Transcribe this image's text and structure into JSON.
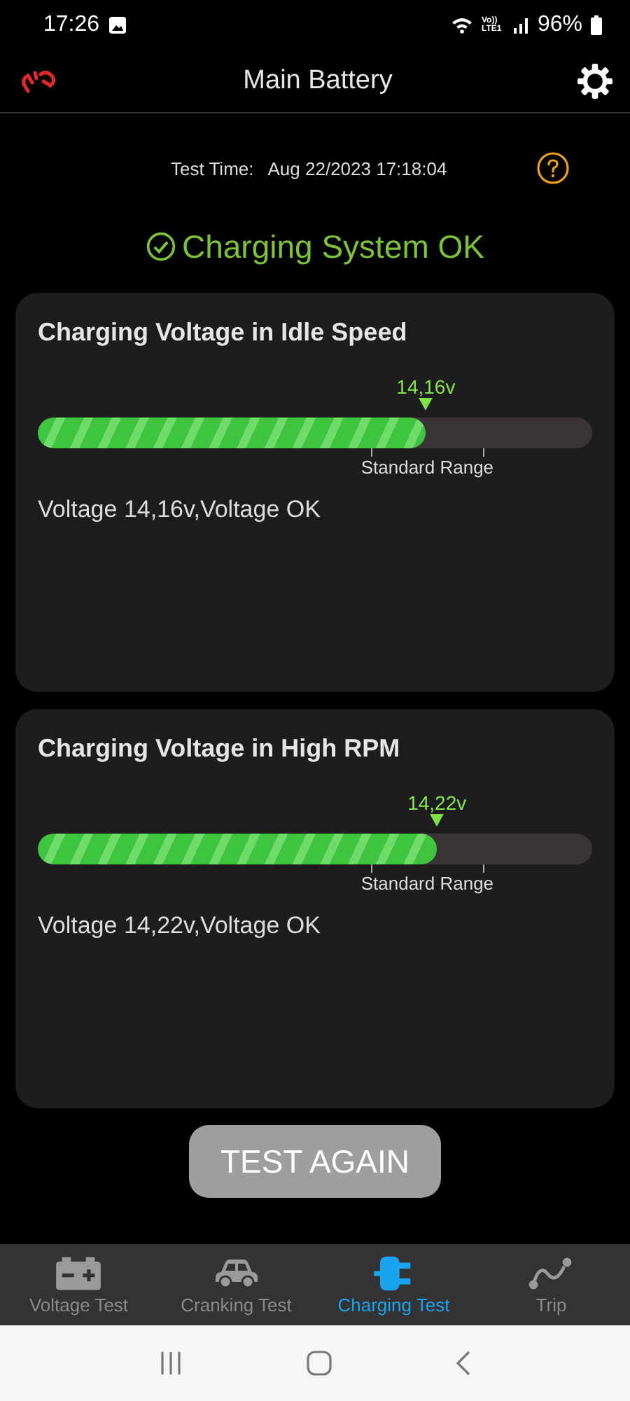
{
  "status_bar": {
    "time": "17:26",
    "network": "Vo)) LTE1",
    "battery": "96%"
  },
  "header": {
    "title": "Main Battery"
  },
  "test_time": {
    "label": "Test Time:",
    "value": "Aug 22/2023 17:18:04"
  },
  "result": {
    "text": "Charging System OK",
    "ok": true
  },
  "cards": [
    {
      "title": "Charging Voltage in Idle Speed",
      "reading": "14,16v",
      "level": 0.7,
      "range_label": "Standard Range",
      "message": "Voltage 14,16v,Voltage OK"
    },
    {
      "title": "Charging Voltage in High RPM",
      "reading": "14,22v",
      "level": 0.72,
      "range_label": "Standard Range",
      "message": "Voltage 14,22v,Voltage OK"
    }
  ],
  "action_button": {
    "label": "TEST AGAIN",
    "disabled": true
  },
  "tabs": [
    {
      "kind": "battery",
      "label": "Voltage Test",
      "selected": false
    },
    {
      "kind": "car",
      "label": "Cranking Test",
      "selected": false
    },
    {
      "kind": "plug",
      "label": "Charging Test",
      "selected": true
    },
    {
      "kind": "trip",
      "label": "Trip",
      "selected": false
    }
  ]
}
